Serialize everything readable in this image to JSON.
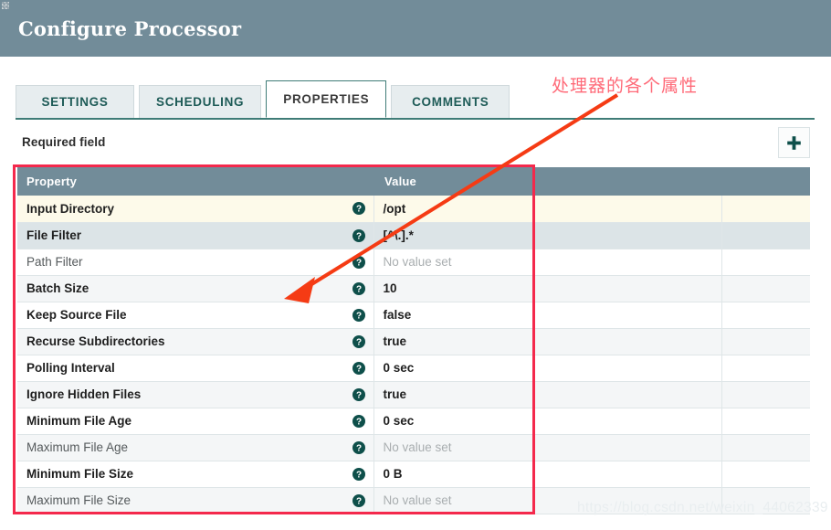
{
  "window": {
    "title": "Configure Processor"
  },
  "tabs": [
    {
      "label": "SETTINGS",
      "active": false
    },
    {
      "label": "SCHEDULING",
      "active": false
    },
    {
      "label": "PROPERTIES",
      "active": true
    },
    {
      "label": "COMMENTS",
      "active": false
    }
  ],
  "toolbar": {
    "required_field_label": "Required field",
    "add_button_label": "+",
    "add_button_icon": "plus-icon"
  },
  "table": {
    "columns": [
      "Property",
      "Value",
      ""
    ],
    "help_icon": "question-mark-icon",
    "rows": [
      {
        "property": "Input Directory",
        "value": "/opt",
        "required": true,
        "value_set": true,
        "row_style": "selected"
      },
      {
        "property": "File Filter",
        "value": "[^\\.].*",
        "required": true,
        "value_set": true,
        "row_style": "highlight"
      },
      {
        "property": "Path Filter",
        "value": "No value set",
        "required": false,
        "value_set": false,
        "row_style": "plain"
      },
      {
        "property": "Batch Size",
        "value": "10",
        "required": true,
        "value_set": true,
        "row_style": "alt"
      },
      {
        "property": "Keep Source File",
        "value": "false",
        "required": true,
        "value_set": true,
        "row_style": "plain"
      },
      {
        "property": "Recurse Subdirectories",
        "value": "true",
        "required": true,
        "value_set": true,
        "row_style": "alt"
      },
      {
        "property": "Polling Interval",
        "value": "0 sec",
        "required": true,
        "value_set": true,
        "row_style": "plain"
      },
      {
        "property": "Ignore Hidden Files",
        "value": "true",
        "required": true,
        "value_set": true,
        "row_style": "alt"
      },
      {
        "property": "Minimum File Age",
        "value": "0 sec",
        "required": true,
        "value_set": true,
        "row_style": "plain"
      },
      {
        "property": "Maximum File Age",
        "value": "No value set",
        "required": false,
        "value_set": false,
        "row_style": "alt"
      },
      {
        "property": "Minimum File Size",
        "value": "0 B",
        "required": true,
        "value_set": true,
        "row_style": "plain"
      },
      {
        "property": "Maximum File Size",
        "value": "No value set",
        "required": false,
        "value_set": false,
        "row_style": "alt"
      }
    ]
  },
  "annotations": {
    "callout_text": "处理器的各个属性",
    "callout_color": "#ff6a78",
    "box_color": "#f4294c",
    "arrow_color": "#f53b14"
  },
  "watermark": {
    "text": "https://blog.csdn.net/weixin_44062339"
  },
  "colors": {
    "header_bg": "#728c99",
    "tab_active_border": "#3f7c77",
    "tab_text": "#1e5b57",
    "help_icon": "#0e4f4a",
    "row_selected": "#fdfaea",
    "row_highlight": "#dce4e7"
  }
}
